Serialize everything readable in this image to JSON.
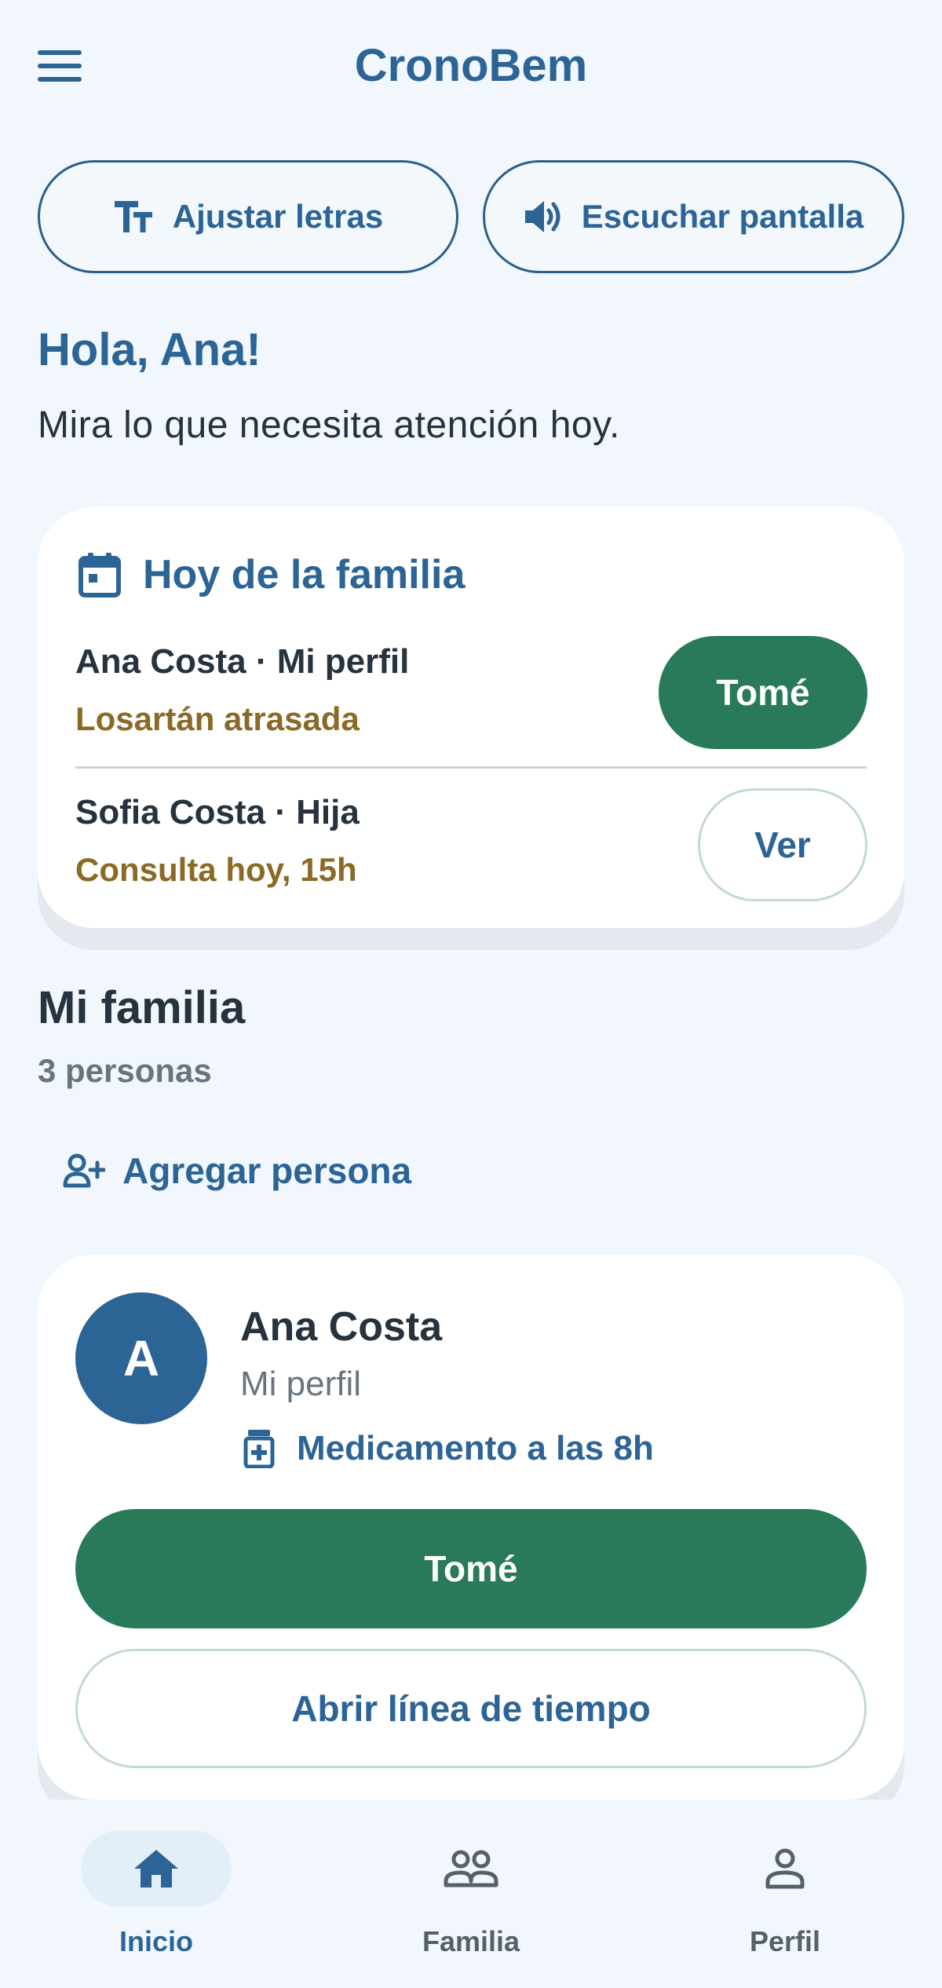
{
  "app": {
    "title": "CronoBem"
  },
  "toolbar": {
    "adjust_text_label": "Ajustar letras",
    "listen_screen_label": "Escuchar pantalla"
  },
  "greeting": {
    "title": "Hola, Ana!",
    "subtitle": "Mira lo que necesita atención hoy."
  },
  "today": {
    "title": "Hoy de la familia",
    "items": [
      {
        "name": "Ana Costa · Mi perfil",
        "note": "Losartán atrasada",
        "action": "Tomé"
      },
      {
        "name": "Sofia Costa · Hija",
        "note": "Consulta hoy, 15h",
        "action": "Ver"
      }
    ]
  },
  "family": {
    "title": "Mi familia",
    "count": "3 personas",
    "add_label": "Agregar persona",
    "members": [
      {
        "initial": "A",
        "name": "Ana Costa",
        "role": "Mi perfil",
        "medication": "Medicamento a las 8h",
        "primary_action": "Tomé",
        "secondary_action": "Abrir línea de tiempo"
      }
    ]
  },
  "nav": {
    "items": [
      {
        "label": "Inicio",
        "icon": "home-icon",
        "active": true
      },
      {
        "label": "Familia",
        "icon": "group-icon",
        "active": false
      },
      {
        "label": "Perfil",
        "icon": "person-icon",
        "active": false
      }
    ]
  },
  "colors": {
    "primary": "#2c6496",
    "success": "#287a58",
    "warning_text": "#8a6a26",
    "background": "#f1f7fc"
  }
}
